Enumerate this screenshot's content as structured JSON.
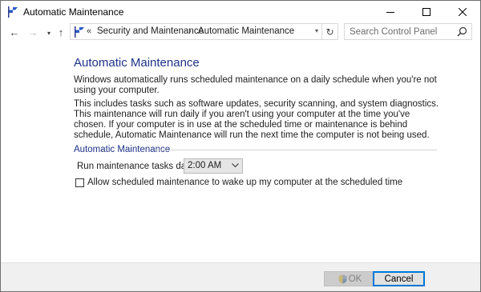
{
  "window": {
    "title": "Automatic Maintenance",
    "minimize_glyph": "—",
    "maximize_glyph": "☐",
    "close_glyph": "✕"
  },
  "nav": {
    "back_glyph": "←",
    "forward_glyph": "→",
    "recent_glyph": "▾",
    "up_glyph": "↑",
    "address": {
      "overflow": "«",
      "separator": "›",
      "dropdown_glyph": "▾",
      "crumbs": [
        "Security and Maintenance",
        "Automatic Maintenance"
      ]
    },
    "refresh_glyph": "↻",
    "search": {
      "placeholder": "Search Control Panel"
    }
  },
  "content": {
    "title": "Automatic Maintenance",
    "paragraph1": "Windows automatically runs scheduled maintenance on a daily schedule when you're not using your computer.",
    "paragraph2": "This includes tasks such as software updates, security scanning, and system diagnostics. This maintenance will run daily if you aren't using your computer at the time you've chosen. If your computer is in use at the scheduled time or maintenance is behind schedule, Automatic Maintenance will run the next time the computer is not being used.",
    "section": {
      "heading": "Automatic Maintenance",
      "run_label": "Run maintenance tasks daily at",
      "time_value": "2:00 AM",
      "wake_label": "Allow scheduled maintenance to wake up my computer at the scheduled time",
      "wake_checked": false
    }
  },
  "footer": {
    "ok_label": "OK",
    "ok_enabled": false,
    "cancel_label": "Cancel"
  },
  "colors": {
    "title_blue": "#1e3287",
    "focus_blue": "#0078d7"
  },
  "icons": {
    "window": "maintenance-flag-icon",
    "search": "search-icon",
    "ok": "uac-shield-icon"
  }
}
